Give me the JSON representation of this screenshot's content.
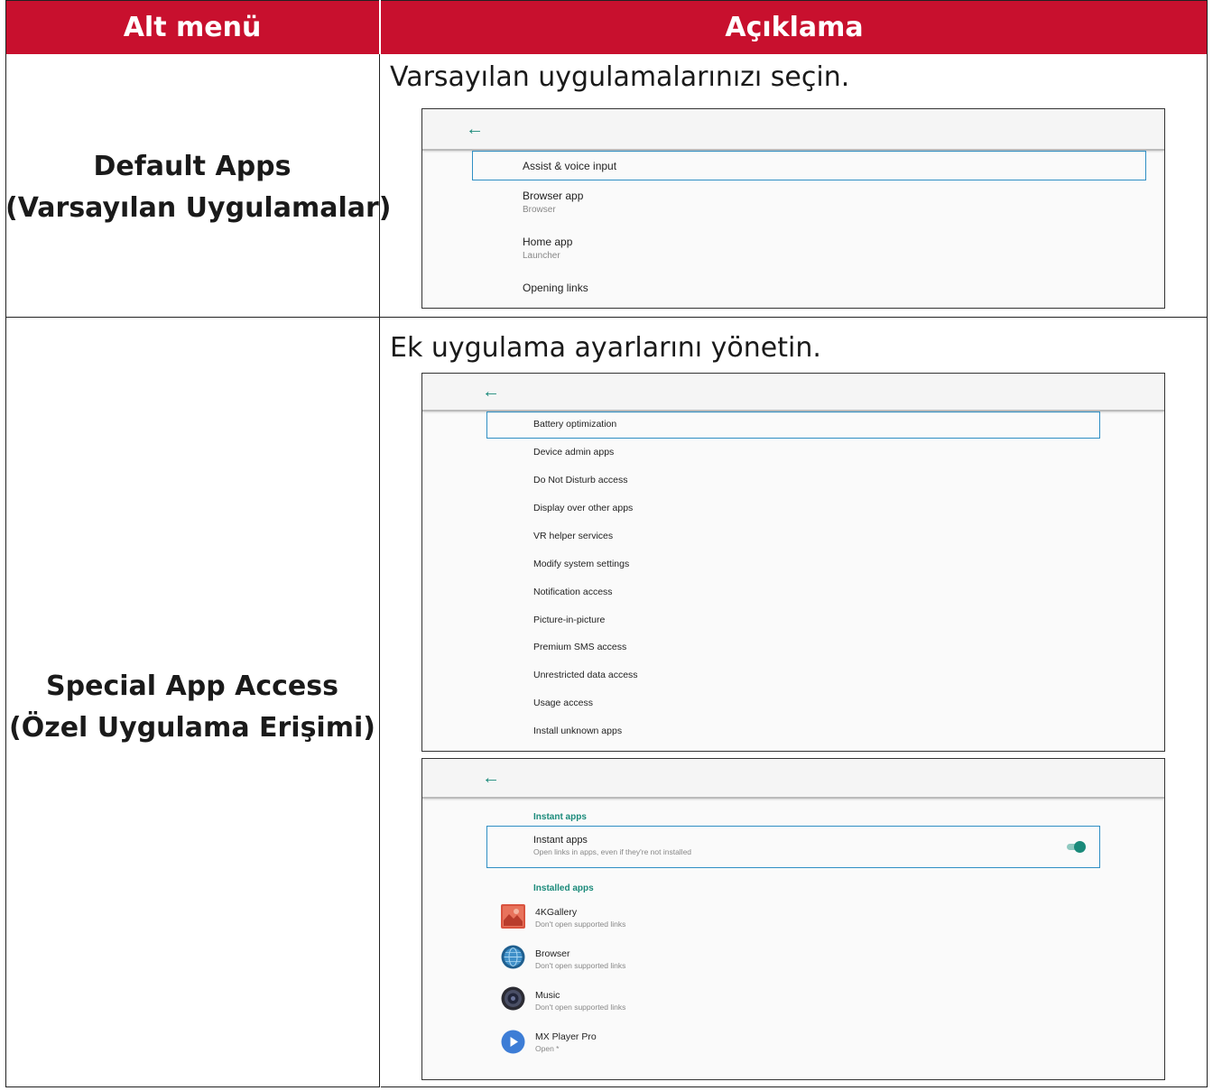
{
  "header": {
    "col1": "Alt menü",
    "col2": "Açıklama"
  },
  "rows": [
    {
      "label_line1": "Default Apps",
      "label_line2": "(Varsayılan Uygulamalar)",
      "description": "Varsayılan uygulamalarınızı seçin.",
      "screenshot": {
        "items": [
          {
            "title": "Assist & voice input",
            "subtitle": ""
          },
          {
            "title": "Browser app",
            "subtitle": "Browser"
          },
          {
            "title": "Home app",
            "subtitle": "Launcher"
          },
          {
            "title": "Opening links",
            "subtitle": ""
          }
        ]
      }
    },
    {
      "label_line1": "Special App Access",
      "label_line2": "(Özel Uygulama Erişimi)",
      "description": "Ek uygulama ayarlarını yönetin.",
      "screenshot1": {
        "items": [
          "Battery optimization",
          "Device admin apps",
          "Do Not Disturb access",
          "Display over other apps",
          "VR helper services",
          "Modify system settings",
          "Notification access",
          "Picture-in-picture",
          "Premium SMS access",
          "Unrestricted data access",
          "Usage access",
          "Install unknown apps"
        ]
      },
      "screenshot2": {
        "section_instant": "Instant apps",
        "instant_title": "Instant apps",
        "instant_subtitle": "Open links in apps, even if they're not installed",
        "instant_toggle_on": true,
        "section_installed": "Installed apps",
        "apps": [
          {
            "name": "4KGallery",
            "status": "Don't open supported links",
            "icon": "gallery-icon"
          },
          {
            "name": "Browser",
            "status": "Don't open supported links",
            "icon": "browser-globe-icon"
          },
          {
            "name": "Music",
            "status": "Don't open supported links",
            "icon": "music-speaker-icon"
          },
          {
            "name": "MX Player Pro",
            "status": "Open *",
            "icon": "play-icon"
          }
        ]
      }
    }
  ],
  "colors": {
    "header_bg": "#c8102e",
    "accent": "#1a8a7a",
    "selection": "#2f8fc4"
  }
}
